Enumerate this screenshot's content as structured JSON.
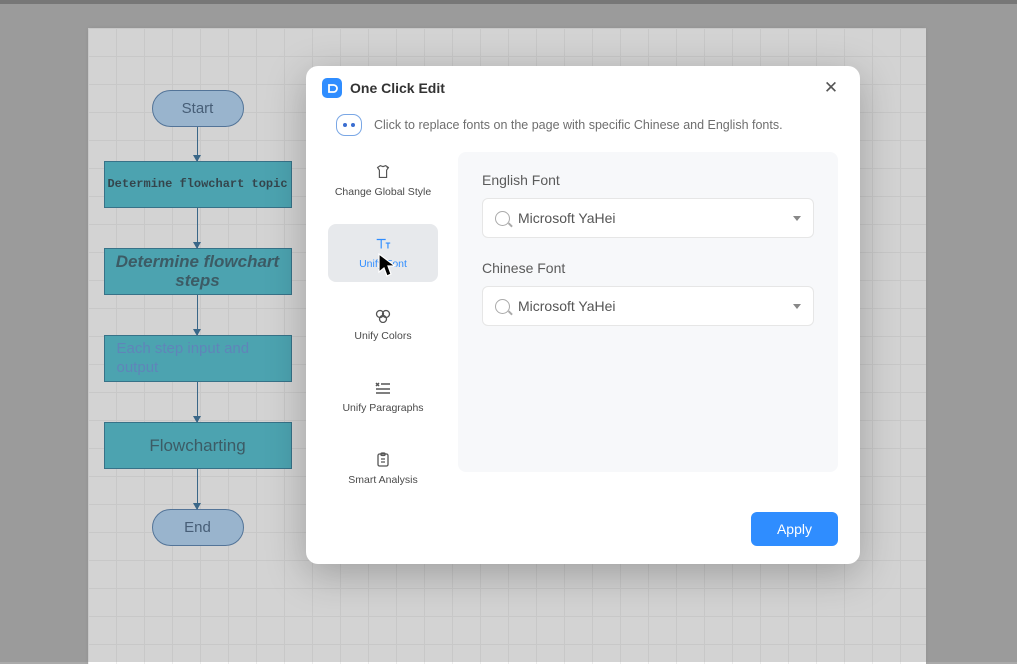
{
  "flowchart": {
    "start": "Start",
    "end": "End",
    "box1": "Determine flowchart topic",
    "box2": "Determine flowchart steps",
    "box3": "Each step input and output",
    "box4": "Flowcharting"
  },
  "dialog": {
    "title": "One Click Edit",
    "description": "Click to replace fonts on the page with specific Chinese and English fonts.",
    "apply": "Apply"
  },
  "sidebar": {
    "items": [
      {
        "label": "Change Global Style"
      },
      {
        "label": "Unify Font"
      },
      {
        "label": "Unify Colors"
      },
      {
        "label": "Unify Paragraphs"
      },
      {
        "label": "Smart Analysis"
      }
    ]
  },
  "panel": {
    "english_label": "English Font",
    "english_value": "Microsoft YaHei",
    "chinese_label": "Chinese Font",
    "chinese_value": "Microsoft YaHei"
  }
}
